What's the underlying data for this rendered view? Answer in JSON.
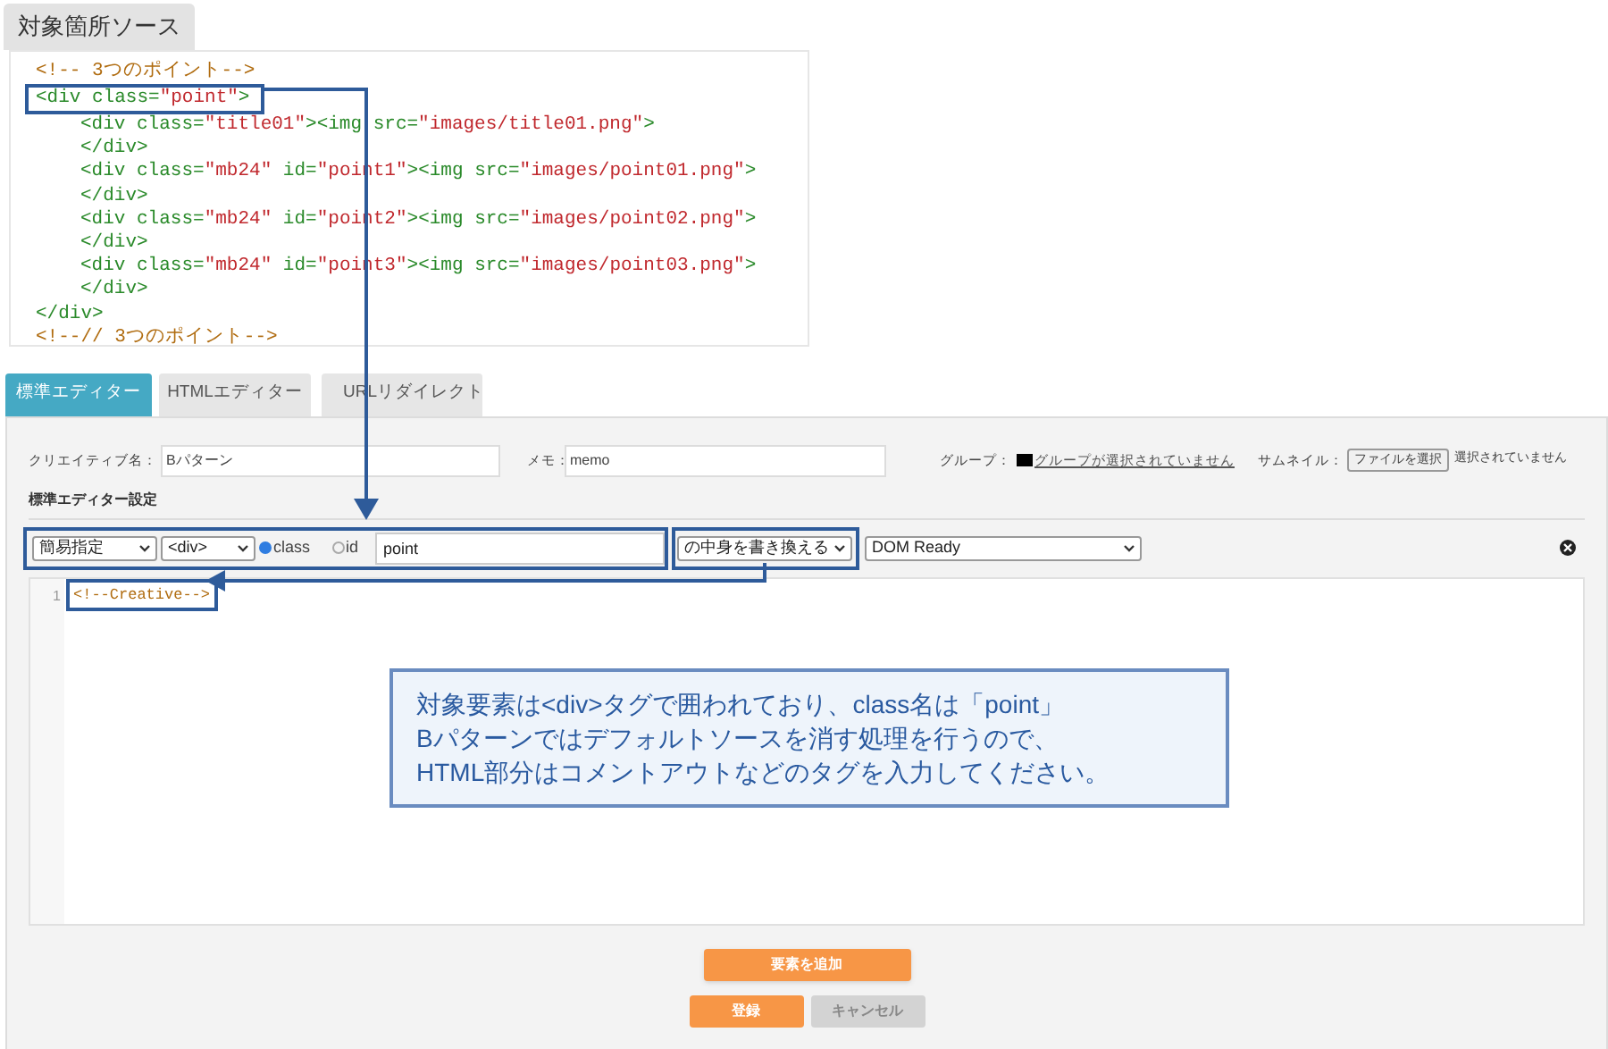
{
  "source_tab": {
    "label": "対象箇所ソース"
  },
  "source_code": [
    {
      "segments": [
        {
          "kind": "comment",
          "text": "<!-- 3つのポイント-->"
        }
      ]
    },
    {
      "highlighted": true,
      "segments": [
        {
          "kind": "tag",
          "text": "<div class="
        },
        {
          "kind": "string",
          "text": "\"point\""
        },
        {
          "kind": "tag",
          "text": ">"
        }
      ],
      "children": [
        {
          "segments": [
            {
              "kind": "tag",
              "text": "<div class="
            },
            {
              "kind": "string",
              "text": "\"title01\""
            },
            {
              "kind": "tag",
              "text": "><img src="
            },
            {
              "kind": "string",
              "text": "\"images/title01.png\""
            },
            {
              "kind": "tag",
              "text": ">"
            }
          ]
        },
        {
          "segments": [
            {
              "kind": "tag",
              "text": "</div>"
            }
          ]
        },
        {
          "segments": [
            {
              "kind": "tag",
              "text": "<div class="
            },
            {
              "kind": "string",
              "text": "\"mb24\""
            },
            {
              "kind": "tag",
              "text": " id="
            },
            {
              "kind": "string",
              "text": "\"point1\""
            },
            {
              "kind": "tag",
              "text": "><img src="
            },
            {
              "kind": "string",
              "text": "\"images/point01.png\""
            },
            {
              "kind": "tag",
              "text": ">"
            }
          ]
        },
        {
          "segments": [
            {
              "kind": "tag",
              "text": "</div>"
            }
          ]
        },
        {
          "segments": [
            {
              "kind": "tag",
              "text": "<div class="
            },
            {
              "kind": "string",
              "text": "\"mb24\""
            },
            {
              "kind": "tag",
              "text": " id="
            },
            {
              "kind": "string",
              "text": "\"point2\""
            },
            {
              "kind": "tag",
              "text": "><img src="
            },
            {
              "kind": "string",
              "text": "\"images/point02.png\""
            },
            {
              "kind": "tag",
              "text": ">"
            }
          ]
        },
        {
          "segments": [
            {
              "kind": "tag",
              "text": "</div>"
            }
          ]
        },
        {
          "segments": [
            {
              "kind": "tag",
              "text": "<div class="
            },
            {
              "kind": "string",
              "text": "\"mb24\""
            },
            {
              "kind": "tag",
              "text": " id="
            },
            {
              "kind": "string",
              "text": "\"point3\""
            },
            {
              "kind": "tag",
              "text": "><img src="
            },
            {
              "kind": "string",
              "text": "\"images/point03.png\""
            },
            {
              "kind": "tag",
              "text": ">"
            }
          ]
        },
        {
          "segments": [
            {
              "kind": "tag",
              "text": "</div>"
            }
          ]
        }
      ]
    },
    {
      "segments": [
        {
          "kind": "tag",
          "text": "</div>"
        }
      ]
    },
    {
      "segments": [
        {
          "kind": "comment",
          "text": "<!--// 3つのポイント-->"
        }
      ]
    }
  ],
  "tabs": [
    {
      "label": "標準エディター",
      "selected": true
    },
    {
      "label": "HTMLエディター",
      "selected": false
    },
    {
      "label": "URLリダイレクト",
      "selected": false
    }
  ],
  "creative_name": {
    "label": "クリエイティブ名：",
    "value": "Bパターン"
  },
  "memo": {
    "label": "メモ：",
    "value": "memo"
  },
  "group": {
    "label": "グループ：",
    "link": "グループが選択されていません"
  },
  "thumbnail": {
    "label": "サムネイル：",
    "button": "ファイルを選択",
    "status": "選択されていません"
  },
  "section_title": "標準エディター設定",
  "rule": {
    "mode": "簡易指定",
    "tag": "<div>",
    "radios": [
      {
        "label": "class",
        "selected": true
      },
      {
        "label": "id",
        "selected": false
      }
    ],
    "selector": "point",
    "action": "の中身を書き換える",
    "timing": "DOM Ready"
  },
  "editor": {
    "lines": [
      {
        "number": "1",
        "text": "<!--Creative-->",
        "highlighted": true
      }
    ]
  },
  "callout": [
    "対象要素は<div>タグで囲われており、class名は「point」",
    "Bパターンではデフォルトソースを消す処理を行うので、",
    "HTML部分はコメントアウトなどのタグを入力してください。"
  ],
  "add_button": {
    "label": "要素を追加"
  },
  "buttons": [
    {
      "label": "登録",
      "kind": "primary"
    },
    {
      "label": "キャンセル",
      "kind": "secondary"
    }
  ]
}
